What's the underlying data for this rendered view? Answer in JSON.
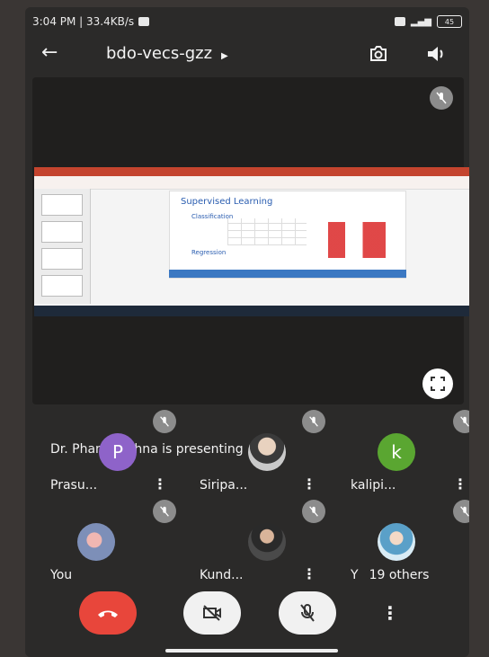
{
  "status_bar": {
    "time_speed": "3:04 PM | 33.4KB/s",
    "battery": "45"
  },
  "meeting": {
    "code": "bdo-vecs-gzz"
  },
  "presentation": {
    "presenter_text": "Dr. Phani Krishna is presenting",
    "slide": {
      "title": "Supervised Learning",
      "bullet_1": "Classification",
      "bullet_2": "Regression"
    }
  },
  "participants": [
    {
      "name": "Prasu...",
      "initial": "P",
      "avatar_color": "#8e63c9"
    },
    {
      "name": "Siripa...",
      "initial": "",
      "avatar_color": "#6a6a6a"
    },
    {
      "name": "kalipi...",
      "initial": "k",
      "avatar_color": "#5aa631"
    },
    {
      "name": "You",
      "initial": "",
      "avatar_color": "#7d8fb8"
    },
    {
      "name": "Kund...",
      "initial": "",
      "avatar_color": "#4a4a4a"
    },
    {
      "name": "19 others",
      "prefix": "Y",
      "initial": "",
      "avatar_color": "#9fbfd8"
    }
  ],
  "colors": {
    "end_call": "#e8463b",
    "control_bg": "#f1f1f1",
    "mute_icon_bg": "#8c8c8c"
  }
}
